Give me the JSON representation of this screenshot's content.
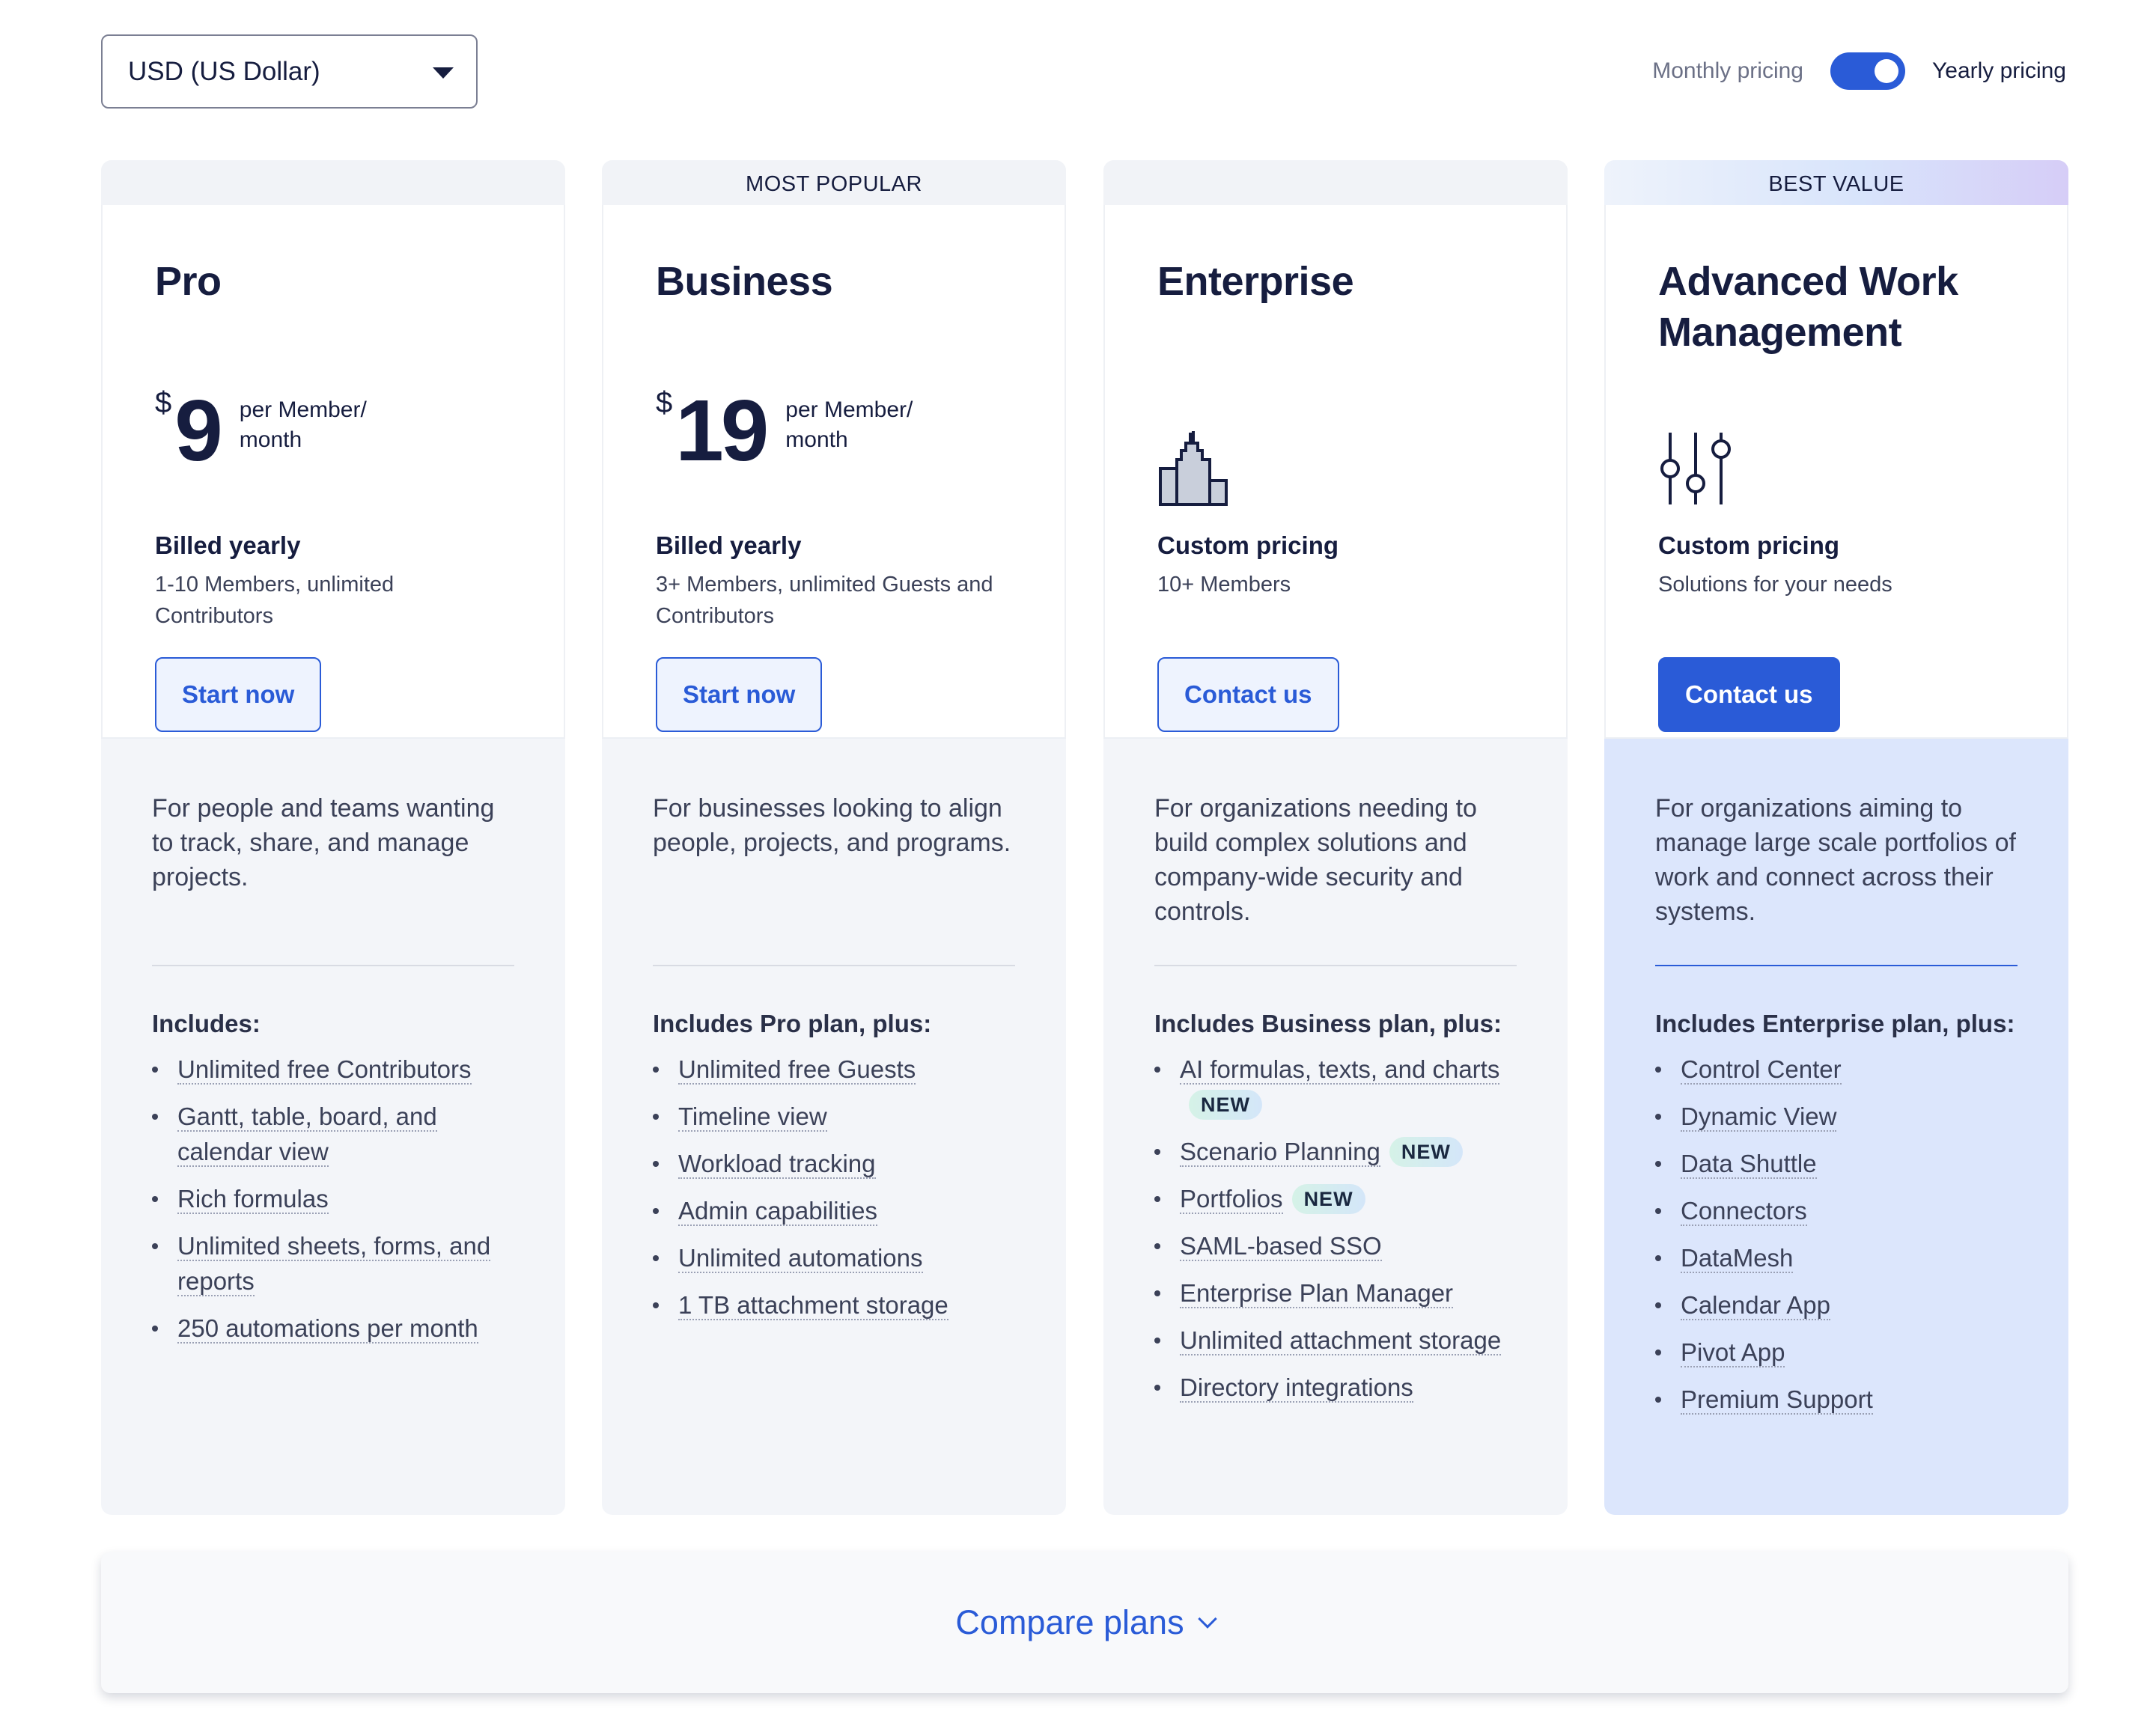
{
  "currency": {
    "selected": "USD (US Dollar)"
  },
  "billing_toggle": {
    "monthly_label": "Monthly pricing",
    "yearly_label": "Yearly pricing",
    "yearly_selected": true
  },
  "colors": {
    "accent": "#2a5bd7",
    "card_bg": "#f3f5f9",
    "best_value_bg": "#dce6fc",
    "text": "#161d3f"
  },
  "plans": [
    {
      "banner": "",
      "name": "Pro",
      "currency_symbol": "$",
      "price": "9",
      "price_unit": "per Member/ month",
      "billing": "Billed yearly",
      "members": "1-10 Members, unlimited Contributors",
      "cta": "Start now",
      "description": "For people and teams wanting to track, share, and manage projects.",
      "includes_title": "Includes:",
      "features": [
        {
          "text": "Unlimited free Contributors"
        },
        {
          "text": "Gantt, table, board, and calendar view"
        },
        {
          "text": "Rich formulas"
        },
        {
          "text": "Unlimited sheets, forms, and reports"
        },
        {
          "text": "250 automations per month"
        }
      ]
    },
    {
      "banner": "MOST POPULAR",
      "name": "Business",
      "currency_symbol": "$",
      "price": "19",
      "price_unit": "per Member/ month",
      "billing": "Billed yearly",
      "members": "3+ Members, unlimited Guests and Contributors",
      "cta": "Start now",
      "description": "For businesses looking to align people, projects, and programs.",
      "includes_title": "Includes Pro plan, plus:",
      "features": [
        {
          "text": "Unlimited free Guests"
        },
        {
          "text": "Timeline view"
        },
        {
          "text": "Workload tracking"
        },
        {
          "text": "Admin capabilities"
        },
        {
          "text": "Unlimited automations"
        },
        {
          "text": "1 TB attachment storage"
        }
      ]
    },
    {
      "banner": "",
      "name": "Enterprise",
      "icon": "building-icon",
      "billing": "Custom pricing",
      "members": "10+ Members",
      "cta": "Contact us",
      "description": "For organizations needing to build complex solutions and company-wide security and controls.",
      "includes_title": "Includes Business plan, plus:",
      "features": [
        {
          "text": "AI formulas, texts, and charts",
          "badge": "NEW"
        },
        {
          "text": "Scenario Planning",
          "badge": "NEW"
        },
        {
          "text": "Portfolios",
          "badge": "NEW"
        },
        {
          "text": "SAML-based SSO"
        },
        {
          "text": "Enterprise Plan Manager"
        },
        {
          "text": "Unlimited attachment storage"
        },
        {
          "text": "Directory integrations"
        }
      ]
    },
    {
      "banner": "BEST VALUE",
      "name": "Advanced Work Management",
      "icon": "sliders-icon",
      "billing": "Custom pricing",
      "members": "Solutions for your needs",
      "cta": "Contact us",
      "description": "For organizations aiming to manage large scale portfolios of work and connect across their systems.",
      "includes_title": "Includes Enterprise plan, plus:",
      "features": [
        {
          "text": "Control Center"
        },
        {
          "text": "Dynamic View"
        },
        {
          "text": "Data Shuttle"
        },
        {
          "text": "Connectors"
        },
        {
          "text": "DataMesh"
        },
        {
          "text": "Calendar App"
        },
        {
          "text": "Pivot App"
        },
        {
          "text": "Premium Support"
        }
      ]
    }
  ],
  "compare": {
    "label": "Compare plans"
  }
}
